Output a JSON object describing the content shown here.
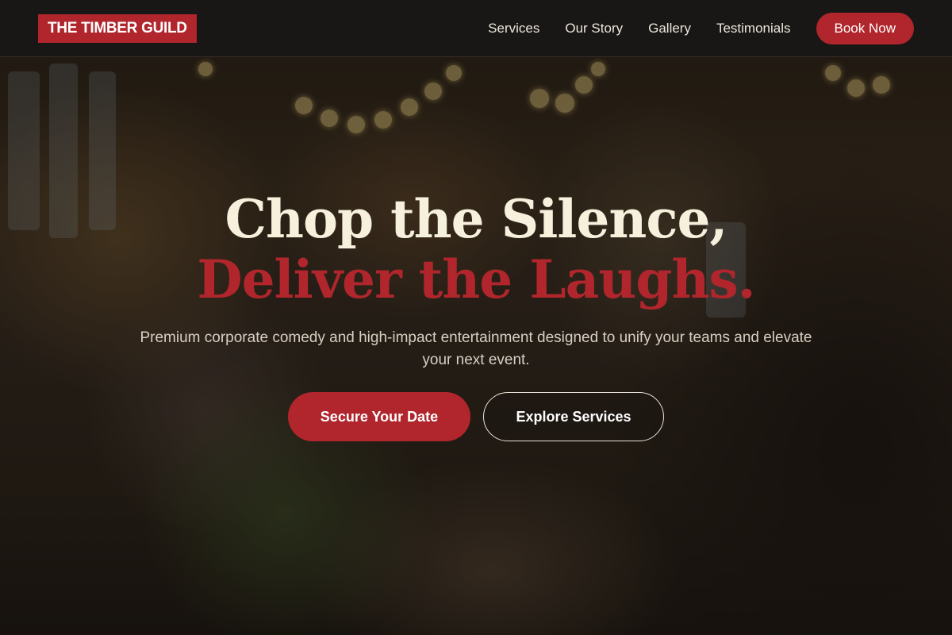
{
  "brand": {
    "name": "THE TIMBER GUILD"
  },
  "nav": {
    "links": [
      "Services",
      "Our Story",
      "Gallery",
      "Testimonials"
    ],
    "book_label": "Book Now"
  },
  "hero": {
    "headline_line1": "Chop the Silence,",
    "headline_line2": "Deliver the Laughs.",
    "subtext": "Premium corporate comedy and high-impact entertainment designed to unify your teams and elevate your next event.",
    "primary_cta": "Secure Your Date",
    "secondary_cta": "Explore Services"
  },
  "colors": {
    "accent": "#b0262c",
    "headline_cream": "#f6f0dc",
    "nav_bg": "#181716"
  }
}
